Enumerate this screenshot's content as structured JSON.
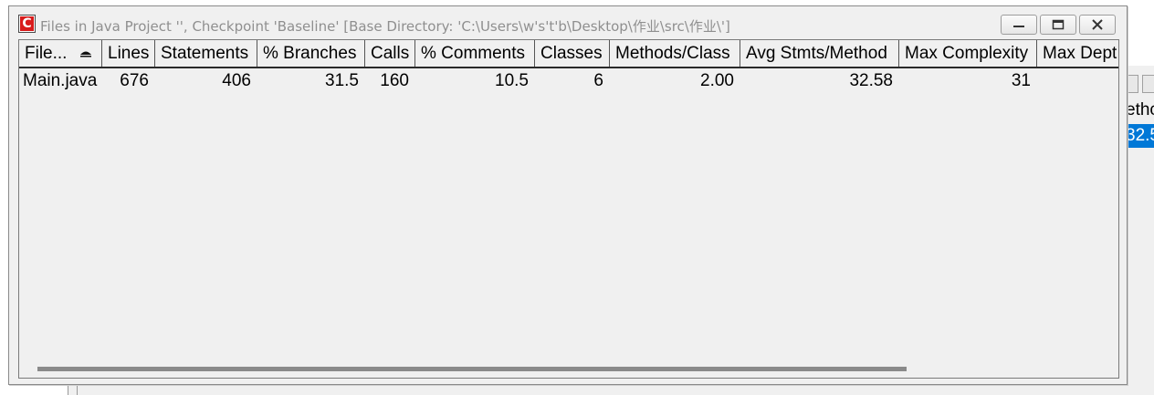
{
  "window": {
    "title": "Files in Java Project '', Checkpoint 'Baseline'  [Base Directory: 'C:\\Users\\w's't'b\\Desktop\\作业\\src\\作业\\']",
    "icon": "c-app-icon",
    "buttons": {
      "minimize": "minimize-icon",
      "maximize": "maximize-icon",
      "close": "close-icon"
    }
  },
  "table": {
    "columns": [
      "File...",
      "Lines",
      "Statements",
      "% Branches",
      "Calls",
      "% Comments",
      "Classes",
      "Methods/Class",
      "Avg Stmts/Method",
      "Max Complexity",
      "Max Dept"
    ],
    "sort_column": "File...",
    "sort_direction": "ascending",
    "rows": [
      [
        "Main.java",
        "676",
        "406",
        "31.5",
        "160",
        "10.5",
        "6",
        "2.00",
        "32.58",
        "31",
        ""
      ]
    ]
  },
  "background_window": {
    "column_fragment": "ethc",
    "selected_value_fragment": "32.5",
    "selection_color": "#0078d7"
  }
}
